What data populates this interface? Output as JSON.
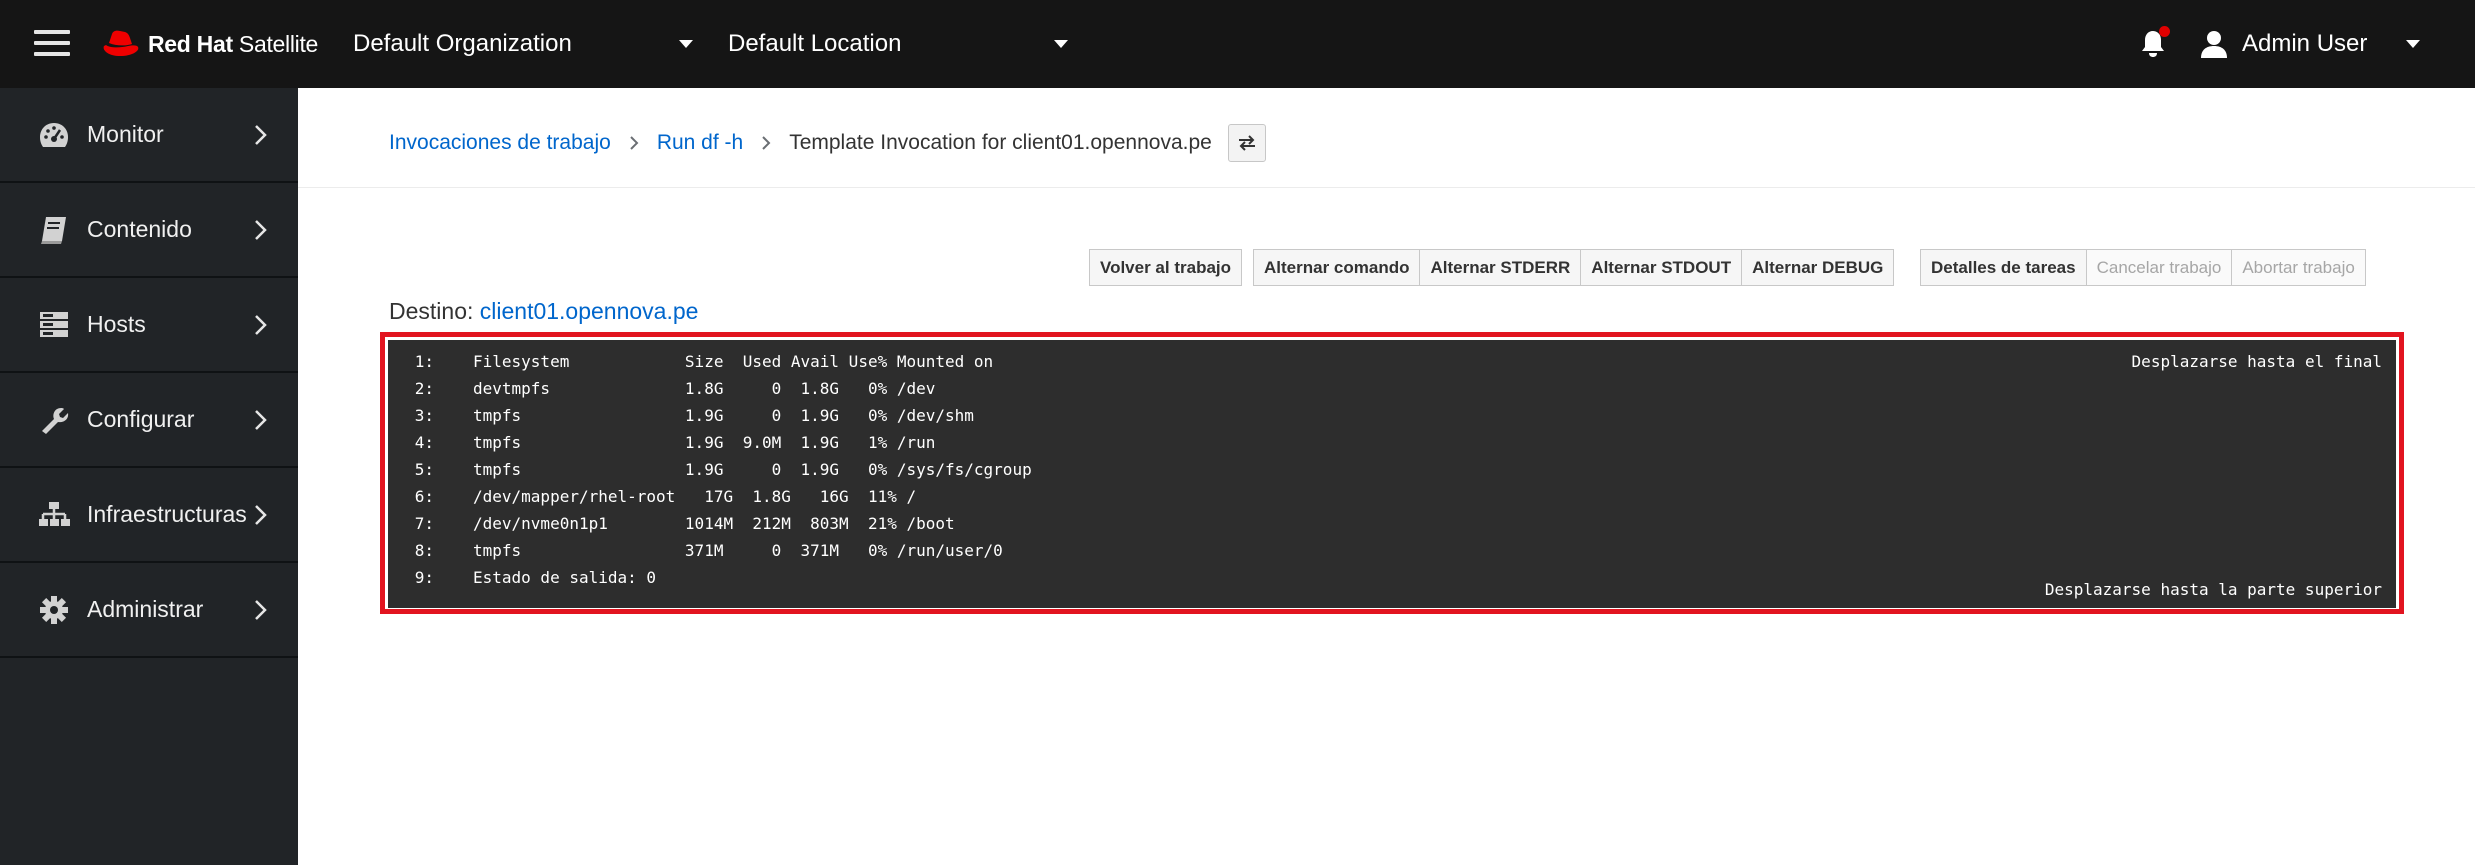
{
  "header": {
    "brand_bold": "Red Hat",
    "brand_rest": "Satellite",
    "organization": "Default Organization",
    "location": "Default Location",
    "user_name": "Admin User",
    "notification_dot_color": "#e00000",
    "logo_color": "#ee0000"
  },
  "sidebar": {
    "items": [
      {
        "label": "Monitor",
        "icon": "dashboard-gauge-icon"
      },
      {
        "label": "Contenido",
        "icon": "book-icon"
      },
      {
        "label": "Hosts",
        "icon": "server-icon"
      },
      {
        "label": "Configurar",
        "icon": "wrench-icon"
      },
      {
        "label": "Infraestructuras",
        "icon": "network-icon"
      },
      {
        "label": "Administrar",
        "icon": "gear-icon"
      }
    ]
  },
  "breadcrumb": {
    "items": [
      "Invocaciones de trabajo",
      "Run df -h"
    ],
    "current": "Template Invocation for client01.opennova.pe"
  },
  "toolbar": {
    "group1": [
      "Volver al trabajo"
    ],
    "group2": [
      "Alternar comando",
      "Alternar STDERR",
      "Alternar STDOUT",
      "Alternar DEBUG"
    ],
    "group3": [
      "Detalles de tareas",
      "Cancelar trabajo",
      "Abortar trabajo"
    ]
  },
  "destino": {
    "label": "Destino:",
    "host": "client01.opennova.pe"
  },
  "output": {
    "scroll_bottom": "Desplazarse hasta el final",
    "scroll_top": "Desplazarse hasta la parte superior",
    "highlight_color": "#e2141f",
    "lines": [
      {
        "n": "1:",
        "text": "Filesystem            Size  Used Avail Use% Mounted on"
      },
      {
        "n": "2:",
        "text": "devtmpfs              1.8G     0  1.8G   0% /dev"
      },
      {
        "n": "3:",
        "text": "tmpfs                 1.9G     0  1.9G   0% /dev/shm"
      },
      {
        "n": "4:",
        "text": "tmpfs                 1.9G  9.0M  1.9G   1% /run"
      },
      {
        "n": "5:",
        "text": "tmpfs                 1.9G     0  1.9G   0% /sys/fs/cgroup"
      },
      {
        "n": "6:",
        "text": "/dev/mapper/rhel-root   17G  1.8G   16G  11% /"
      },
      {
        "n": "7:",
        "text": "/dev/nvme0n1p1        1014M  212M  803M  21% /boot"
      },
      {
        "n": "8:",
        "text": "tmpfs                 371M     0  371M   0% /run/user/0"
      },
      {
        "n": "9:",
        "text": "Estado de salida: 0"
      }
    ]
  }
}
